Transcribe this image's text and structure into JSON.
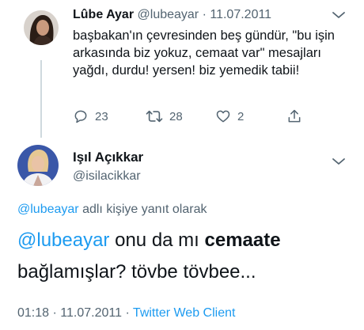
{
  "tweet1": {
    "name": "Lûbe Ayar",
    "handle": "@lubeayar",
    "separator": "·",
    "date": "11.07.2011",
    "text": "başbakan'ın çevresinden beş gündür, \"bu işin arkasında biz yokuz, cemaat var\" mesajları yağdı, durdu! yersen! biz yemedik tabii!",
    "actions": {
      "replies": "23",
      "retweets": "28",
      "likes": "2"
    }
  },
  "tweet2": {
    "name": "Işıl Açıkkar",
    "handle": "@isilacikkar",
    "reply_to_mention": "@lubeayar",
    "reply_to_suffix": " adlı kişiye yanıt olarak",
    "text_mention": "@lubeayar",
    "text_part1": " onu da mı ",
    "text_bold": "cemaate",
    "text_part2": " bağlamışlar? tövbe tövbee...",
    "time": "01:18",
    "separator": "·",
    "date": "11.07.2011",
    "separator2": "·",
    "client": "Twitter Web Client"
  },
  "colors": {
    "accent": "#1d9bf0",
    "secondary_text": "#536471",
    "primary_text": "#0f1419",
    "thread_line": "#cfd9de"
  },
  "icons": [
    "more-icon",
    "reply-icon",
    "retweet-icon",
    "like-icon",
    "share-icon"
  ]
}
